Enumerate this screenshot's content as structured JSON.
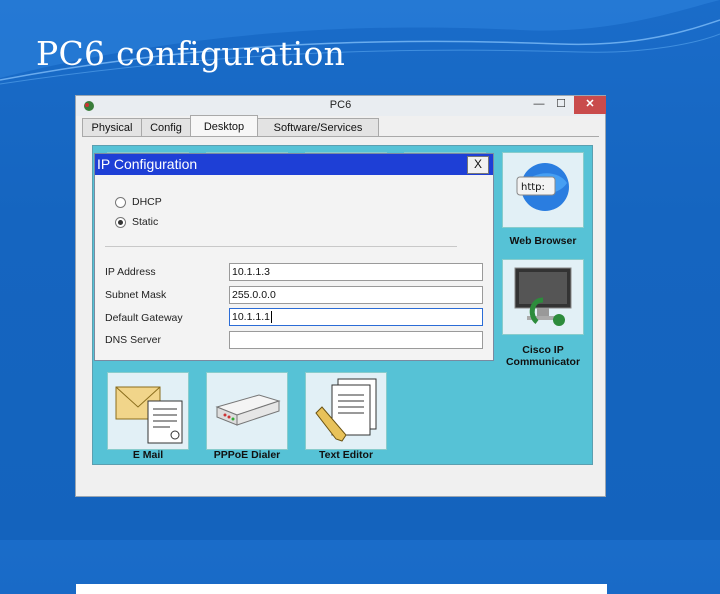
{
  "slide": {
    "title": "PC6 configuration"
  },
  "window": {
    "title": "PC6",
    "controls": {
      "minimize": "—",
      "maximize": "☐",
      "close": "✕"
    },
    "tabs": [
      {
        "label": "Physical",
        "active": false
      },
      {
        "label": "Config",
        "active": false
      },
      {
        "label": "Desktop",
        "active": true
      },
      {
        "label": "Software/Services",
        "active": false
      }
    ]
  },
  "desktop_apps": [
    {
      "label": "Web Browser",
      "icon": "web-browser-icon"
    },
    {
      "label": "Cisco IP Communicator",
      "icon": "cisco-ip-communicator-icon"
    },
    {
      "label": "E Mail",
      "icon": "email-icon"
    },
    {
      "label": "PPPoE Dialer",
      "icon": "pppoe-dialer-icon"
    },
    {
      "label": "Text Editor",
      "icon": "text-editor-icon"
    }
  ],
  "ip_dialog": {
    "title": "IP Configuration",
    "close": "X",
    "dhcp_label": "DHCP",
    "static_label": "Static",
    "selected_mode": "Static",
    "fields": [
      {
        "label": "IP Address",
        "value": "10.1.1.3"
      },
      {
        "label": "Subnet Mask",
        "value": "255.0.0.0"
      },
      {
        "label": "Default Gateway",
        "value": "10.1.1.1"
      },
      {
        "label": "DNS Server",
        "value": ""
      }
    ],
    "web_browser_tile_text": "http:"
  },
  "colors": {
    "background": "#1565c0",
    "dialog_title": "#1e3fd6",
    "desktop": "#56c2d6"
  }
}
